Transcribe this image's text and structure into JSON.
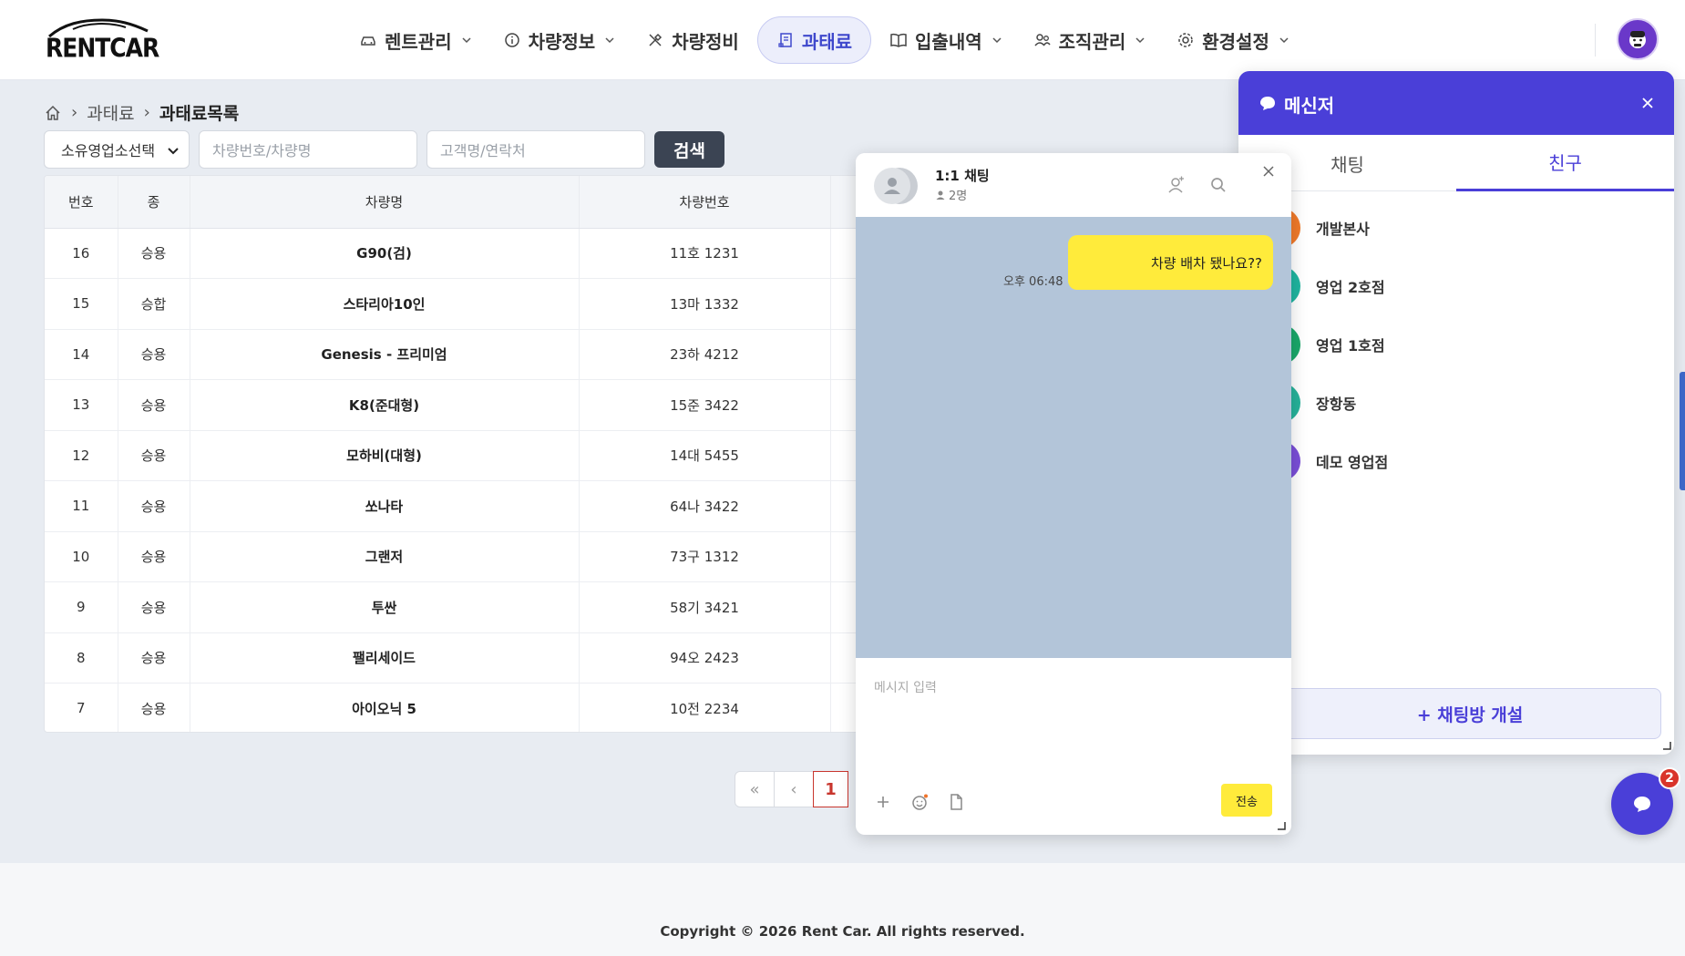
{
  "header": {
    "logo": "RENTCAR",
    "nav": [
      {
        "label": "렌트관리",
        "icon": "car-icon",
        "dropdown": true,
        "active": false
      },
      {
        "label": "차량정보",
        "icon": "info-icon",
        "dropdown": true,
        "active": false
      },
      {
        "label": "차량정비",
        "icon": "tools-icon",
        "dropdown": false,
        "active": false
      },
      {
        "label": "과태료",
        "icon": "receipt-icon",
        "dropdown": false,
        "active": true
      },
      {
        "label": "입출내역",
        "icon": "book-icon",
        "dropdown": true,
        "active": false
      },
      {
        "label": "조직관리",
        "icon": "users-icon",
        "dropdown": true,
        "active": false
      },
      {
        "label": "환경설정",
        "icon": "gear-icon",
        "dropdown": true,
        "active": false
      }
    ]
  },
  "breadcrumb": {
    "parent": "과태료",
    "current": "과태료목록"
  },
  "filters": {
    "select_value": "소유영업소선택",
    "input1_placeholder": "차량번호/차량명",
    "input2_placeholder": "고객명/연락처",
    "search_label": "검색"
  },
  "table": {
    "headers": [
      "번호",
      "종",
      "차량명",
      "차량번호"
    ],
    "rows": [
      {
        "no": "16",
        "type": "승용",
        "name": "G90(검)",
        "plate": "11호 1231"
      },
      {
        "no": "15",
        "type": "승합",
        "name": "스타리아10인",
        "plate": "13마 1332"
      },
      {
        "no": "14",
        "type": "승용",
        "name": "Genesis - 프리미엄",
        "plate": "23하 4212"
      },
      {
        "no": "13",
        "type": "승용",
        "name": "K8(준대형)",
        "plate": "15준 3422"
      },
      {
        "no": "12",
        "type": "승용",
        "name": "모하비(대형)",
        "plate": "14대 5455"
      },
      {
        "no": "11",
        "type": "승용",
        "name": "쏘나타",
        "plate": "64나 3422"
      },
      {
        "no": "10",
        "type": "승용",
        "name": "그랜저",
        "plate": "73구 1312"
      },
      {
        "no": "9",
        "type": "승용",
        "name": "투싼",
        "plate": "58기 3421"
      },
      {
        "no": "8",
        "type": "승용",
        "name": "팰리세이드",
        "plate": "94오 2423"
      },
      {
        "no": "7",
        "type": "승용",
        "name": "아이오닉 5",
        "plate": "10전 2234"
      }
    ]
  },
  "pagination": {
    "first": "«",
    "prev": "‹",
    "current": "1"
  },
  "footer": {
    "copyright": "Copyright © 2026 Rent Car. All rights reserved."
  },
  "chat": {
    "title": "1:1 채팅",
    "member_count": "2명",
    "messages": [
      {
        "text": "차량 배차 됐나요??",
        "time": "오후 06:48"
      }
    ],
    "input_placeholder": "메시지 입력",
    "send_label": "전송"
  },
  "messenger": {
    "title": "메신저",
    "tabs": [
      {
        "label": "채팅",
        "active": false
      },
      {
        "label": "친구",
        "active": true
      }
    ],
    "friends": [
      {
        "name": "개발본사",
        "color": "#f07a2a"
      },
      {
        "name": "영업 2호점",
        "color": "#1fb5a0"
      },
      {
        "name": "영업 1호점",
        "color": "#1aa86a"
      },
      {
        "name": "장항동",
        "color": "#26b29a"
      },
      {
        "name": "데모 영업점",
        "color": "#7a4fd8"
      }
    ],
    "new_room_label": "+ 채팅방 개설"
  },
  "fab": {
    "badge": "2"
  },
  "colors": {
    "accent": "#4a3fd8",
    "bubble": "#ffeb3b",
    "chat_bg": "#b3c5d9"
  }
}
